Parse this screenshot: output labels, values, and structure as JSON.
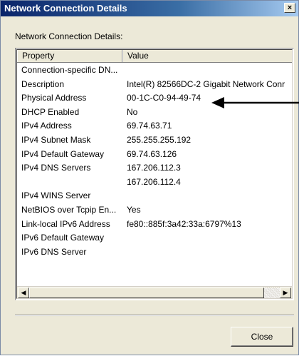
{
  "window": {
    "title": "Network Connection Details",
    "close_glyph": "×"
  },
  "group_label": "Network Connection Details:",
  "list": {
    "columns": [
      "Property",
      "Value"
    ],
    "rows": [
      [
        "Connection-specific DN...",
        ""
      ],
      [
        "Description",
        "Intel(R) 82566DC-2 Gigabit Network Conr"
      ],
      [
        "Physical Address",
        "00-1C-C0-94-49-74"
      ],
      [
        "DHCP Enabled",
        "No"
      ],
      [
        "IPv4 Address",
        "69.74.63.71"
      ],
      [
        "IPv4 Subnet Mask",
        "255.255.255.192"
      ],
      [
        "IPv4 Default Gateway",
        "69.74.63.126"
      ],
      [
        "IPv4 DNS Servers",
        "167.206.112.3"
      ],
      [
        "",
        "167.206.112.4"
      ],
      [
        "IPv4 WINS Server",
        ""
      ],
      [
        "NetBIOS over Tcpip En...",
        "Yes"
      ],
      [
        "Link-local IPv6 Address",
        "fe80::885f:3a42:33a:6797%13"
      ],
      [
        "IPv6 Default Gateway",
        ""
      ],
      [
        "IPv6 DNS Server",
        ""
      ]
    ],
    "scroll_left_glyph": "◀",
    "scroll_right_glyph": "▶"
  },
  "buttons": {
    "close_label": "Close"
  },
  "annotation_icon": "arrow-left-icon"
}
